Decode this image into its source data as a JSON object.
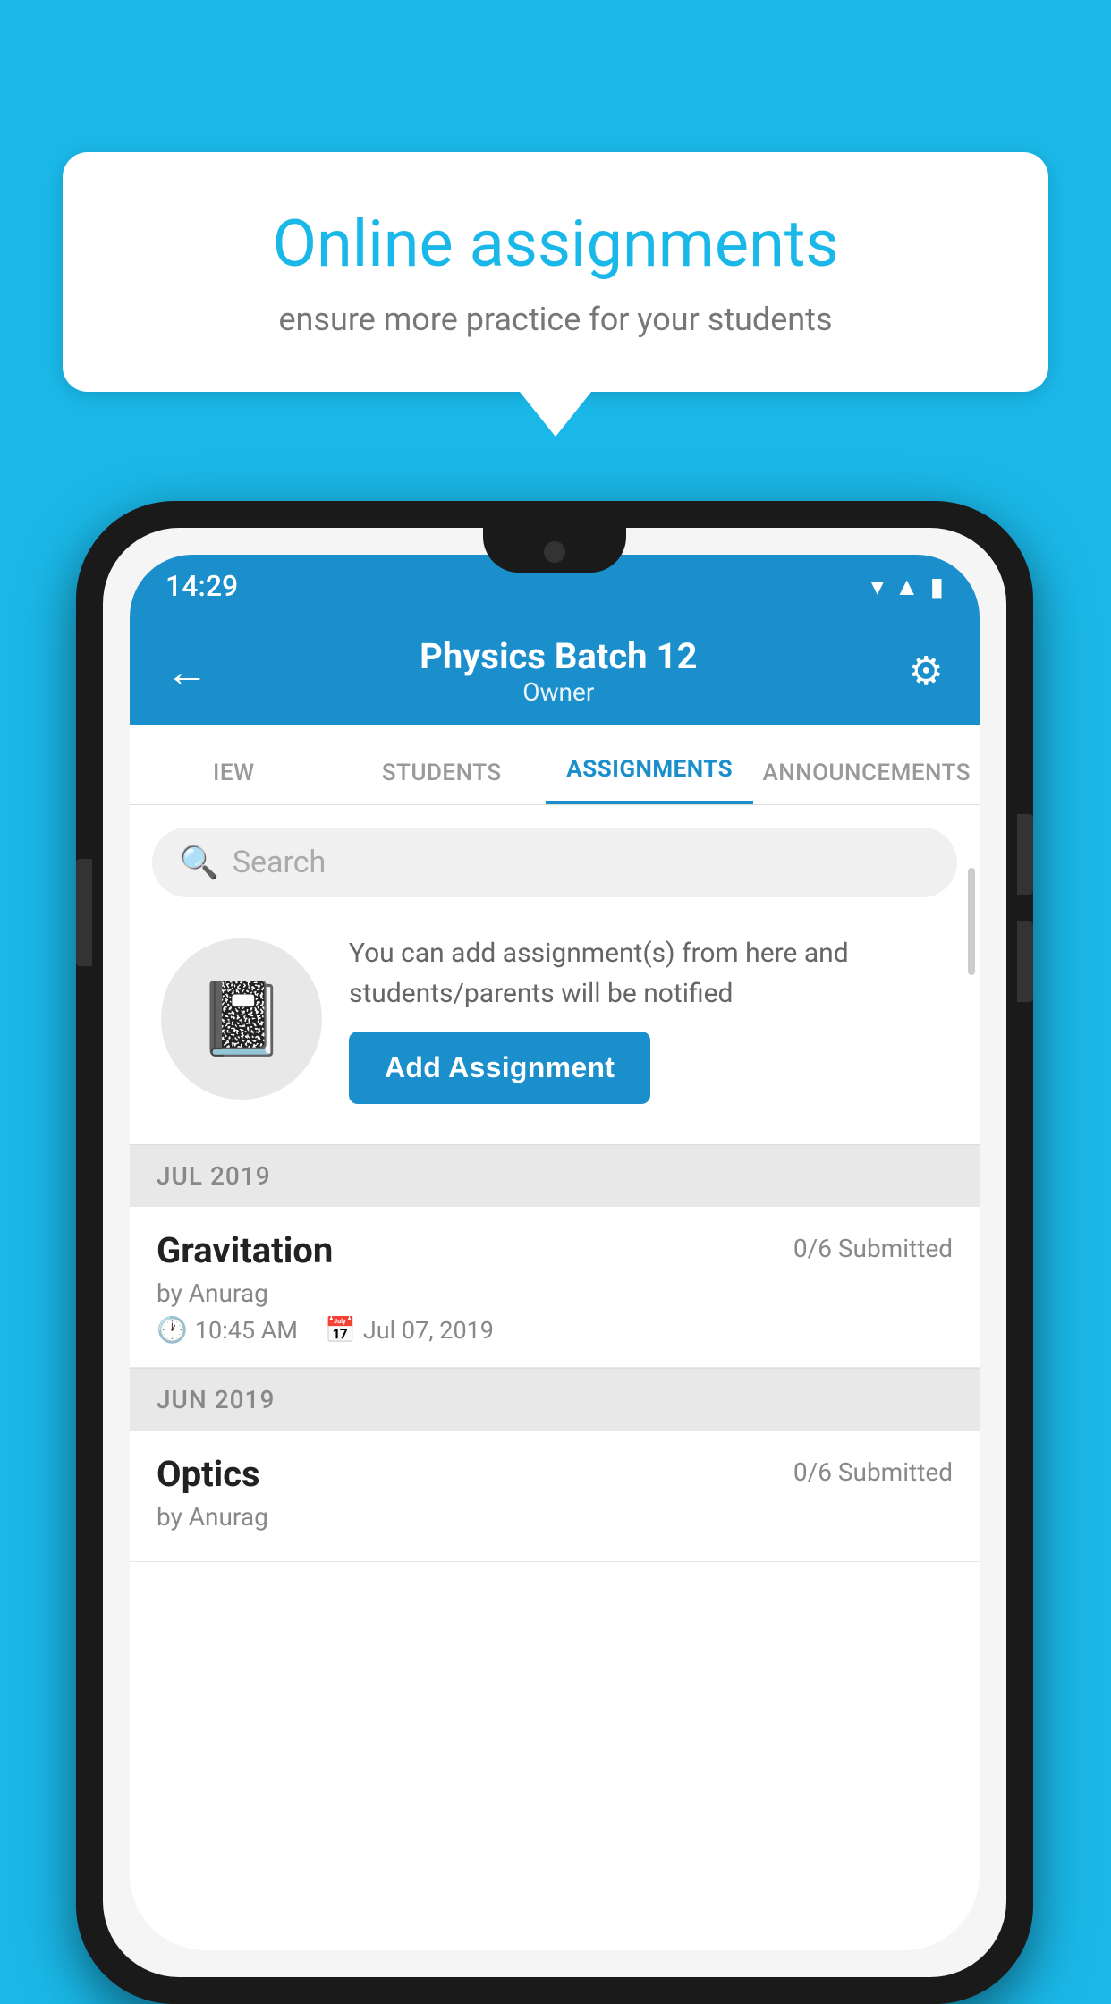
{
  "background_color": "#1ab8e8",
  "speech_bubble": {
    "title": "Online assignments",
    "subtitle": "ensure more practice for your students"
  },
  "status_bar": {
    "time": "14:29",
    "icons": [
      "wifi",
      "signal",
      "battery"
    ]
  },
  "header": {
    "back_label": "←",
    "title": "Physics Batch 12",
    "subtitle": "Owner",
    "settings_label": "⚙"
  },
  "tabs": [
    {
      "label": "IEW",
      "active": false
    },
    {
      "label": "STUDENTS",
      "active": false
    },
    {
      "label": "ASSIGNMENTS",
      "active": true
    },
    {
      "label": "ANNOUNCEMENTS",
      "active": false
    }
  ],
  "search": {
    "placeholder": "Search"
  },
  "promo": {
    "description": "You can add assignment(s) from here and students/parents will be notified",
    "button_label": "Add Assignment"
  },
  "sections": [
    {
      "month_label": "JUL 2019",
      "assignments": [
        {
          "name": "Gravitation",
          "submitted": "0/6 Submitted",
          "by": "by Anurag",
          "time": "10:45 AM",
          "date": "Jul 07, 2019"
        }
      ]
    },
    {
      "month_label": "JUN 2019",
      "assignments": [
        {
          "name": "Optics",
          "submitted": "0/6 Submitted",
          "by": "by Anurag",
          "time": "",
          "date": ""
        }
      ]
    }
  ]
}
